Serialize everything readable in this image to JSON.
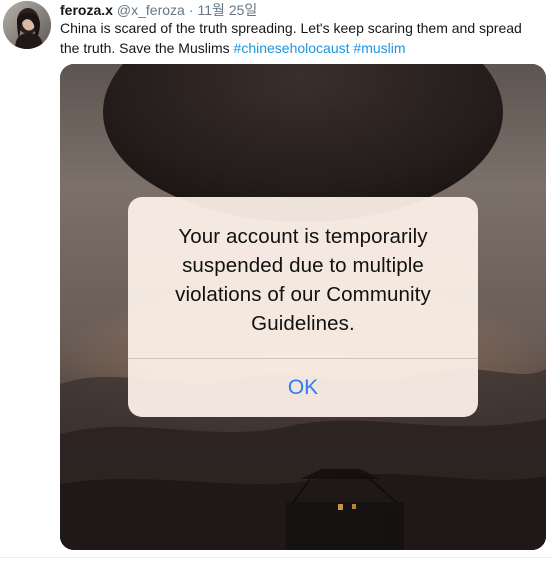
{
  "tweet": {
    "avatar_icon": "user-avatar",
    "display_name": "feroza.x",
    "handle": "@x_feroza",
    "separator": "·",
    "date": "11월 25일",
    "text": "China is scared of the truth spreading. Let's keep scaring them and spread the truth. Save the Muslims",
    "hashtags": [
      "#chineseholocaust",
      "#muslim"
    ],
    "hashtag_color": "#1b95e0"
  },
  "media": {
    "alert": {
      "message_lines": [
        "Your account is temporarily",
        "suspended due to multiple",
        "violations of our Community",
        "Guidelines."
      ],
      "button_label": "OK",
      "button_color": "#2f7cf6"
    }
  }
}
